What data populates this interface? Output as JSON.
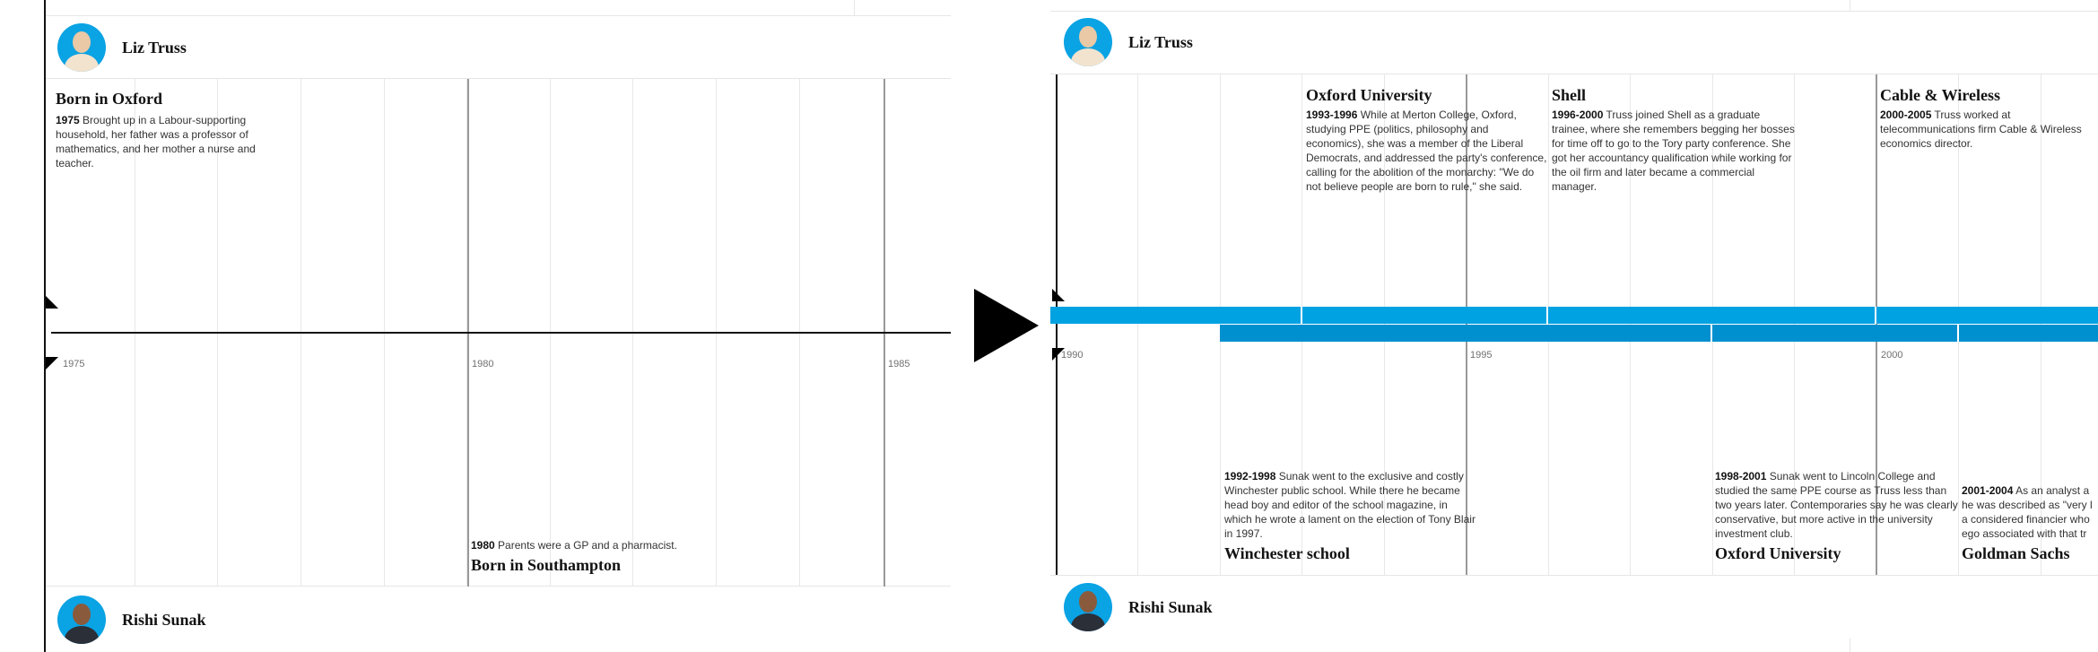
{
  "left": {
    "truss_name": "Liz Truss",
    "sunak_name": "Rishi Sunak",
    "axis_years": [
      "1975",
      "1980",
      "1985"
    ],
    "truss_event": {
      "title": "Born in Oxford",
      "years": "1975",
      "text": "Brought up in a Labour-supporting household, her father was a professor of mathematics, and her mother a nurse and teacher."
    },
    "sunak_event": {
      "title": "Born in Southampton",
      "years": "1980",
      "text": "Parents were a GP and a pharmacist."
    }
  },
  "right": {
    "truss_name": "Liz Truss",
    "sunak_name": "Rishi Sunak",
    "axis_years": [
      "1990",
      "1995",
      "2000"
    ],
    "truss_events": [
      {
        "title": "Oxford University",
        "years": "1993-1996",
        "text": "While at Merton College, Oxford, studying PPE (politics, philosophy and economics), she was a member of the Liberal Democrats, and addressed the party's conference, calling for the abolition of the monarchy: \"We do not believe people are born to rule,\" she said."
      },
      {
        "title": "Shell",
        "years": "1996-2000",
        "text": "Truss joined Shell as a graduate trainee, where she remembers begging her bosses for time off to go to the Tory party conference. She got her accountancy qualification while working for the oil firm and later became a commercial manager."
      },
      {
        "title": "Cable & Wireless",
        "years": "2000-2005",
        "text": "Truss worked at telecommunications firm Cable & Wireless economics director."
      }
    ],
    "sunak_events": [
      {
        "title": "Winchester school",
        "years": "1992-1998",
        "text": "Sunak went to the exclusive and costly Winchester public school. While there he became head boy and editor of the school magazine, in which he wrote a lament on the election of Tony Blair in 1997."
      },
      {
        "title": "Oxford University",
        "years": "1998-2001",
        "text": "Sunak went to Lincoln College and studied the same PPE course as Truss less than two years later. Contemporaries say he was clearly conservative, but more active in the university investment club."
      },
      {
        "title": "Goldman Sachs",
        "years": "2001-2004",
        "text": "As an analyst a he was described as \"very l a considered financier who ego associated with that tr"
      }
    ]
  },
  "colors": {
    "truss_bar": "#00a2e2",
    "sunak_bar": "#0090cf",
    "axis": "#121212",
    "avatar_bg": "#0aa3e4"
  }
}
